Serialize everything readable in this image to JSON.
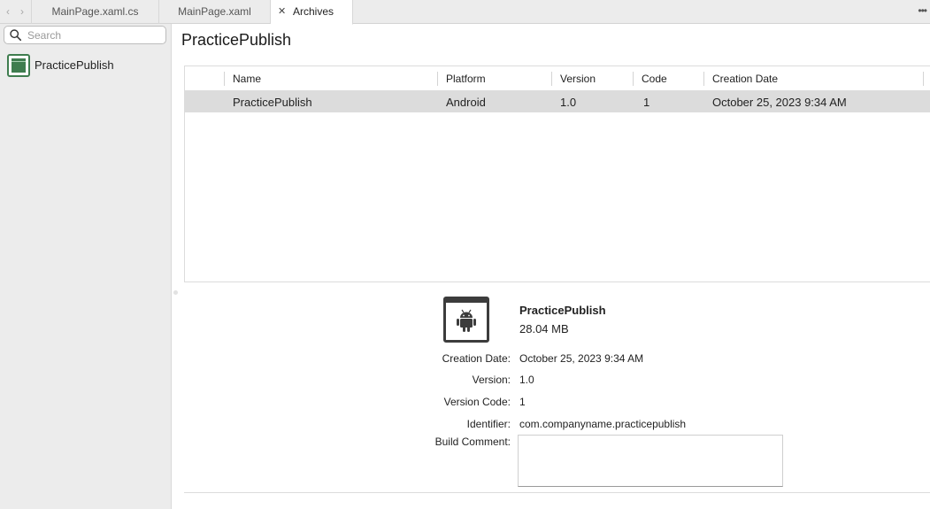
{
  "tabs": [
    {
      "label": "MainPage.xaml.cs",
      "active": false
    },
    {
      "label": "MainPage.xaml",
      "active": false
    },
    {
      "label": "Archives",
      "active": true
    }
  ],
  "sidebar": {
    "search_placeholder": "Search",
    "items": [
      {
        "label": "PracticePublish",
        "icon": "app-window-icon"
      }
    ]
  },
  "main": {
    "title": "PracticePublish",
    "table": {
      "columns": [
        "Name",
        "Platform",
        "Version",
        "Code",
        "Creation Date"
      ],
      "rows": [
        [
          "PracticePublish",
          "Android",
          "1.0",
          "1",
          "October 25, 2023 9:34 AM"
        ]
      ]
    }
  },
  "details": {
    "icon": "android-icon",
    "name": "PracticePublish",
    "size": "28.04 MB",
    "fields": [
      {
        "label": "Creation Date:",
        "value": "October 25, 2023 9:34 AM"
      },
      {
        "label": "Version:",
        "value": "1.0"
      },
      {
        "label": "Version Code:",
        "value": "1"
      },
      {
        "label": "Identifier:",
        "value": "com.companyname.practicepublish"
      }
    ],
    "build_comment_label": "Build Comment:",
    "build_comment_value": ""
  },
  "colors": {
    "accent": "#3f7d4f",
    "selected_row": "#dcdcdc",
    "sidebar_bg": "#ececec"
  }
}
